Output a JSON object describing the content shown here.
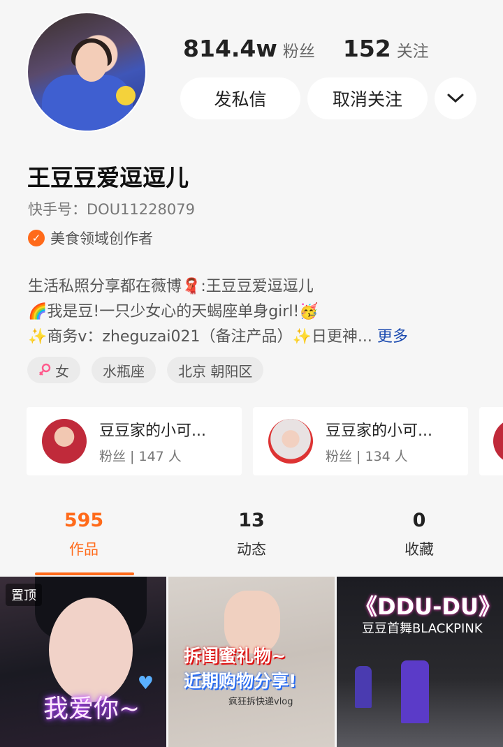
{
  "profile": {
    "followers_count": "814.4w",
    "followers_label": "粉丝",
    "following_count": "152",
    "following_label": "关注",
    "message_button": "发私信",
    "unfollow_button": "取消关注",
    "name": "王豆豆爱逗逗儿",
    "kuaishou_id": "快手号：DOU11228079",
    "certification": "美食领域创作者",
    "bio_lines": [
      "生活私照分享都在薇博🧣:王豆豆爱逗逗儿",
      "🌈我是豆!一只少女心的天蝎座单身girl!🥳",
      "✨商务v：zheguzai021（备注产品）✨日更神..."
    ],
    "bio_more": "更多",
    "tags": [
      "女",
      "水瓶座",
      "北京 朝阳区"
    ]
  },
  "fan_groups": [
    {
      "name": "豆豆家的小可...",
      "members": "粉丝 | 147 人"
    },
    {
      "name": "豆豆家的小可...",
      "members": "粉丝 | 134 人"
    }
  ],
  "tabs": [
    {
      "count": "595",
      "label": "作品"
    },
    {
      "count": "13",
      "label": "动态"
    },
    {
      "count": "0",
      "label": "收藏"
    }
  ],
  "videos": [
    {
      "badge": "置顶",
      "overlay_text": "我爱你~"
    },
    {
      "title_line1": "拆闺蜜礼物~",
      "title_line2": "近期购物分享!",
      "subtitle": "疯狂拆快递vlog"
    },
    {
      "title": "《DDU-DU》",
      "subtitle": "豆豆首舞BLACKPINK"
    }
  ],
  "colors": {
    "accent": "#ff6a1a",
    "link": "#1c4bb0"
  }
}
